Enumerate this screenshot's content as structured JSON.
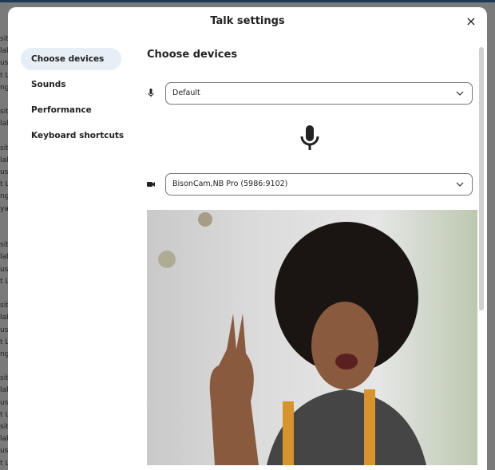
{
  "background": {
    "fragments": [
      "sit",
      "lab",
      "ust",
      "t L",
      "ng",
      "",
      "sit",
      "lab",
      "",
      "sit",
      "lab",
      "ust",
      "t L",
      "ng",
      "ya",
      "",
      "",
      "sit",
      "lab",
      "ust",
      "t L",
      "",
      "sit",
      "lab",
      "ust",
      "t L",
      "ng",
      "",
      "sit",
      "lab",
      "ust",
      "t L",
      "sit",
      "lab",
      "ust",
      "t L"
    ]
  },
  "dialog": {
    "title": "Talk settings",
    "close_label": "×",
    "nav": [
      {
        "label": "Choose devices",
        "active": true
      },
      {
        "label": "Sounds"
      },
      {
        "label": "Performance"
      },
      {
        "label": "Keyboard shortcuts"
      }
    ],
    "section_title": "Choose devices",
    "microphone": {
      "icon": "microphone-icon",
      "value": "Default"
    },
    "camera": {
      "icon": "video-camera-icon",
      "value": "BisonCam,NB Pro (5986:9102)"
    }
  }
}
